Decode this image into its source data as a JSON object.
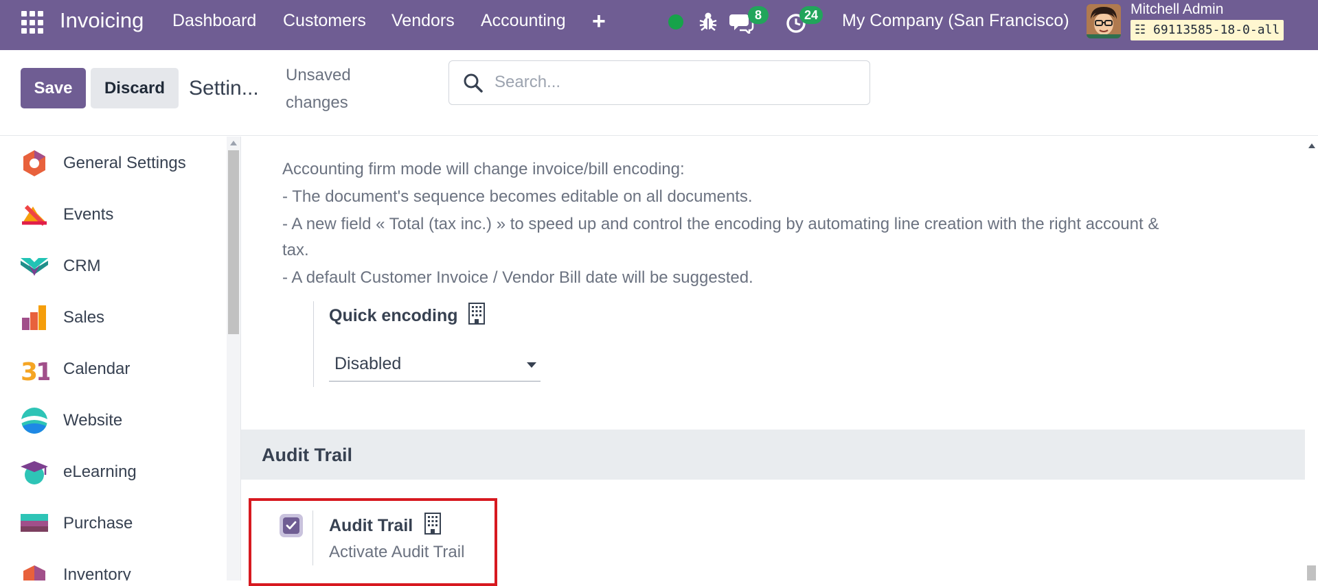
{
  "navbar": {
    "app_name": "Invoicing",
    "menu": [
      "Dashboard",
      "Customers",
      "Vendors",
      "Accounting"
    ],
    "chat_count": "8",
    "activity_count": "24",
    "company": "My Company (San Francisco)",
    "user_name": "Mitchell Admin",
    "database": "69113585-18-0-all"
  },
  "control_panel": {
    "save_label": "Save",
    "discard_label": "Discard",
    "breadcrumb": "Settin...",
    "unsaved": "Unsaved changes",
    "search_placeholder": "Search..."
  },
  "sidebar": {
    "items": [
      {
        "label": "General Settings",
        "icon": "general-settings-icon"
      },
      {
        "label": "Events",
        "icon": "events-icon"
      },
      {
        "label": "CRM",
        "icon": "crm-icon"
      },
      {
        "label": "Sales",
        "icon": "sales-icon"
      },
      {
        "label": "Calendar",
        "icon": "calendar-icon"
      },
      {
        "label": "Website",
        "icon": "website-icon"
      },
      {
        "label": "eLearning",
        "icon": "elearning-icon"
      },
      {
        "label": "Purchase",
        "icon": "purchase-icon"
      },
      {
        "label": "Inventory",
        "icon": "inventory-icon"
      }
    ]
  },
  "content": {
    "description": [
      "Accounting firm mode will change invoice/bill encoding:",
      "- The document's sequence becomes editable on all documents.",
      "- A new field « Total (tax inc.) » to speed up and control the encoding by automating line creation with the right account &",
      "tax.",
      "- A default Customer Invoice / Vendor Bill date will be suggested."
    ],
    "quick_encoding": {
      "title": "Quick encoding",
      "value": "Disabled"
    },
    "audit_section": {
      "header": "Audit Trail",
      "setting_title": "Audit Trail",
      "setting_description": "Activate Audit Trail",
      "checked": true
    }
  },
  "colors": {
    "brand": "#6f5d93",
    "badge": "#22a55b",
    "status_online": "#16a34a",
    "highlight": "#d71920"
  }
}
